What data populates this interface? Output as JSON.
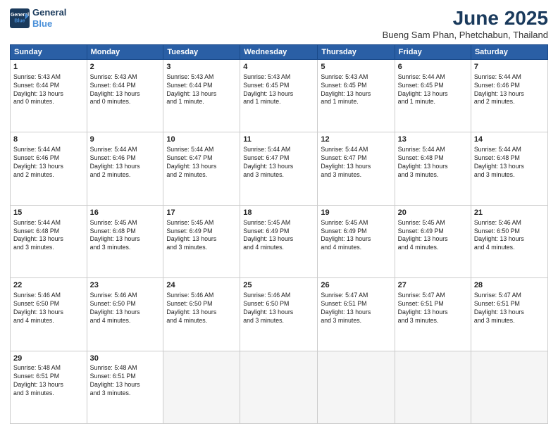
{
  "logo": {
    "line1": "General",
    "line2": "Blue"
  },
  "title": "June 2025",
  "location": "Bueng Sam Phan, Phetchabun, Thailand",
  "days_of_week": [
    "Sunday",
    "Monday",
    "Tuesday",
    "Wednesday",
    "Thursday",
    "Friday",
    "Saturday"
  ],
  "weeks": [
    [
      {
        "day": "1",
        "info": "Sunrise: 5:43 AM\nSunset: 6:44 PM\nDaylight: 13 hours\nand 0 minutes."
      },
      {
        "day": "2",
        "info": "Sunrise: 5:43 AM\nSunset: 6:44 PM\nDaylight: 13 hours\nand 0 minutes."
      },
      {
        "day": "3",
        "info": "Sunrise: 5:43 AM\nSunset: 6:44 PM\nDaylight: 13 hours\nand 1 minute."
      },
      {
        "day": "4",
        "info": "Sunrise: 5:43 AM\nSunset: 6:45 PM\nDaylight: 13 hours\nand 1 minute."
      },
      {
        "day": "5",
        "info": "Sunrise: 5:43 AM\nSunset: 6:45 PM\nDaylight: 13 hours\nand 1 minute."
      },
      {
        "day": "6",
        "info": "Sunrise: 5:44 AM\nSunset: 6:45 PM\nDaylight: 13 hours\nand 1 minute."
      },
      {
        "day": "7",
        "info": "Sunrise: 5:44 AM\nSunset: 6:46 PM\nDaylight: 13 hours\nand 2 minutes."
      }
    ],
    [
      {
        "day": "8",
        "info": "Sunrise: 5:44 AM\nSunset: 6:46 PM\nDaylight: 13 hours\nand 2 minutes."
      },
      {
        "day": "9",
        "info": "Sunrise: 5:44 AM\nSunset: 6:46 PM\nDaylight: 13 hours\nand 2 minutes."
      },
      {
        "day": "10",
        "info": "Sunrise: 5:44 AM\nSunset: 6:47 PM\nDaylight: 13 hours\nand 2 minutes."
      },
      {
        "day": "11",
        "info": "Sunrise: 5:44 AM\nSunset: 6:47 PM\nDaylight: 13 hours\nand 3 minutes."
      },
      {
        "day": "12",
        "info": "Sunrise: 5:44 AM\nSunset: 6:47 PM\nDaylight: 13 hours\nand 3 minutes."
      },
      {
        "day": "13",
        "info": "Sunrise: 5:44 AM\nSunset: 6:48 PM\nDaylight: 13 hours\nand 3 minutes."
      },
      {
        "day": "14",
        "info": "Sunrise: 5:44 AM\nSunset: 6:48 PM\nDaylight: 13 hours\nand 3 minutes."
      }
    ],
    [
      {
        "day": "15",
        "info": "Sunrise: 5:44 AM\nSunset: 6:48 PM\nDaylight: 13 hours\nand 3 minutes."
      },
      {
        "day": "16",
        "info": "Sunrise: 5:45 AM\nSunset: 6:48 PM\nDaylight: 13 hours\nand 3 minutes."
      },
      {
        "day": "17",
        "info": "Sunrise: 5:45 AM\nSunset: 6:49 PM\nDaylight: 13 hours\nand 3 minutes."
      },
      {
        "day": "18",
        "info": "Sunrise: 5:45 AM\nSunset: 6:49 PM\nDaylight: 13 hours\nand 4 minutes."
      },
      {
        "day": "19",
        "info": "Sunrise: 5:45 AM\nSunset: 6:49 PM\nDaylight: 13 hours\nand 4 minutes."
      },
      {
        "day": "20",
        "info": "Sunrise: 5:45 AM\nSunset: 6:49 PM\nDaylight: 13 hours\nand 4 minutes."
      },
      {
        "day": "21",
        "info": "Sunrise: 5:46 AM\nSunset: 6:50 PM\nDaylight: 13 hours\nand 4 minutes."
      }
    ],
    [
      {
        "day": "22",
        "info": "Sunrise: 5:46 AM\nSunset: 6:50 PM\nDaylight: 13 hours\nand 4 minutes."
      },
      {
        "day": "23",
        "info": "Sunrise: 5:46 AM\nSunset: 6:50 PM\nDaylight: 13 hours\nand 4 minutes."
      },
      {
        "day": "24",
        "info": "Sunrise: 5:46 AM\nSunset: 6:50 PM\nDaylight: 13 hours\nand 4 minutes."
      },
      {
        "day": "25",
        "info": "Sunrise: 5:46 AM\nSunset: 6:50 PM\nDaylight: 13 hours\nand 3 minutes."
      },
      {
        "day": "26",
        "info": "Sunrise: 5:47 AM\nSunset: 6:51 PM\nDaylight: 13 hours\nand 3 minutes."
      },
      {
        "day": "27",
        "info": "Sunrise: 5:47 AM\nSunset: 6:51 PM\nDaylight: 13 hours\nand 3 minutes."
      },
      {
        "day": "28",
        "info": "Sunrise: 5:47 AM\nSunset: 6:51 PM\nDaylight: 13 hours\nand 3 minutes."
      }
    ],
    [
      {
        "day": "29",
        "info": "Sunrise: 5:48 AM\nSunset: 6:51 PM\nDaylight: 13 hours\nand 3 minutes."
      },
      {
        "day": "30",
        "info": "Sunrise: 5:48 AM\nSunset: 6:51 PM\nDaylight: 13 hours\nand 3 minutes."
      },
      {
        "day": "",
        "info": ""
      },
      {
        "day": "",
        "info": ""
      },
      {
        "day": "",
        "info": ""
      },
      {
        "day": "",
        "info": ""
      },
      {
        "day": "",
        "info": ""
      }
    ]
  ]
}
